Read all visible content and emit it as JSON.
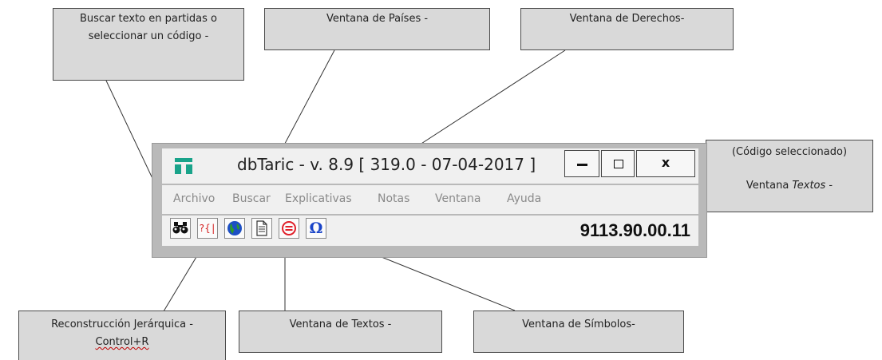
{
  "window": {
    "title": "dbTaric - v. 8.9 [ 319.0 - 07-04-2017 ]",
    "controls": {
      "minimize": "",
      "maximize": "",
      "close": "x"
    },
    "menu": [
      "Archivo",
      "Buscar",
      "Explicativas",
      "Notas",
      "Ventana",
      "Ayuda"
    ],
    "toolbar": [
      {
        "icon": "binoculars-icon",
        "tooltip": "Buscar"
      },
      {
        "icon": "hierarchy-icon",
        "label": "?{|"
      },
      {
        "icon": "globe-icon"
      },
      {
        "icon": "document-icon"
      },
      {
        "icon": "rights-icon"
      },
      {
        "icon": "omega-icon",
        "label": "Ω"
      }
    ],
    "selected_code": "9113.90.00.11"
  },
  "callouts": {
    "search": {
      "line1": "Buscar texto en partidas o",
      "line2": "seleccionar un código -"
    },
    "countries": "Ventana de Países -",
    "rights": "Ventana de Derechos-",
    "selected_code": {
      "line1": "(Código seleccionado)",
      "line2_prefix": "Ventana ",
      "line2_italic": "Textos",
      "line2_suffix": " -"
    },
    "hierarchy": {
      "line1": "Reconstrucción Jerárquica -",
      "line2": "Control+R"
    },
    "texts": "Ventana de Textos -",
    "symbols": "Ventana de Símbolos-"
  },
  "colors": {
    "callout_bg": "#d9d9d9",
    "frame": "#b9b9b9",
    "client": "#f0f0f0",
    "app_icon": "#19a38a",
    "symbol_red": "#e0202a",
    "symbol_blue": "#1a44c8"
  }
}
